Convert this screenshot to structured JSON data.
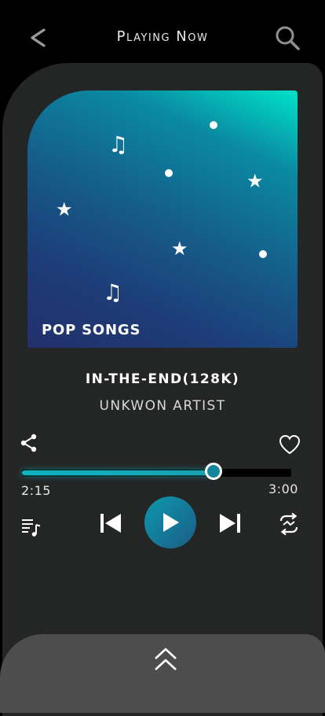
{
  "header": {
    "title": "Playing Now",
    "back_icon": "chevron-left-icon",
    "search_icon": "search-icon"
  },
  "album": {
    "title": "POP SONGS",
    "gradient_colors": [
      "#00e3c8",
      "#155d8a",
      "#22306c"
    ]
  },
  "track": {
    "title": "IN-THE-END(128K)",
    "artist": "UNKWON ARTIST"
  },
  "actions": {
    "share_icon": "share-icon",
    "favorite_icon": "heart-icon"
  },
  "progress": {
    "elapsed": "2:15",
    "total": "3:00",
    "fraction": 0.71
  },
  "controls": {
    "playlist_icon": "playlist-icon",
    "previous_icon": "skip-previous-icon",
    "play_icon": "play-icon",
    "next_icon": "skip-next-icon",
    "repeat_icon": "repeat-icon"
  },
  "bottom_sheet": {
    "expand_icon": "double-chevron-up-icon"
  },
  "colors": {
    "accent": "#14869c",
    "panel": "#242525",
    "sheet": "#4d4d4d"
  }
}
